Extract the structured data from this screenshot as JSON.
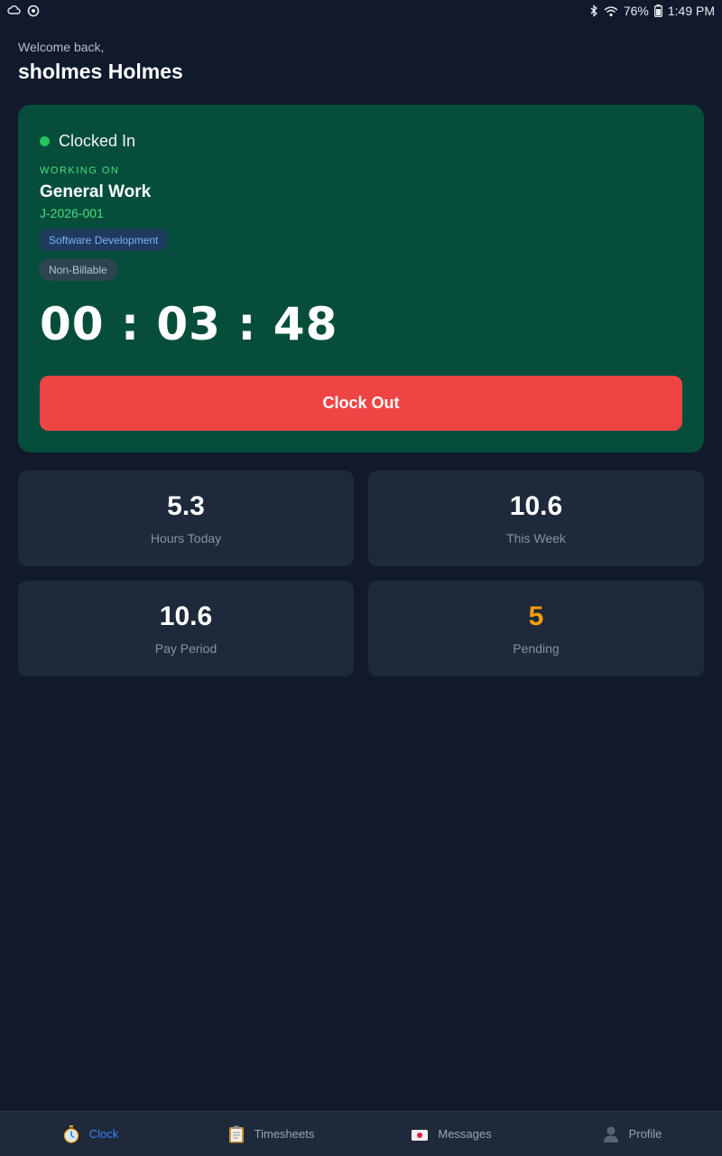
{
  "status_bar": {
    "battery": "76%",
    "time": "1:49 PM"
  },
  "greeting": {
    "welcome": "Welcome back,",
    "name": "sholmes Holmes"
  },
  "clock_card": {
    "status": "Clocked In",
    "working_on_label": "WORKING ON",
    "job_name": "General Work",
    "job_code": "J-2026-001",
    "category_tag": "Software Development",
    "billable_tag": "Non-Billable",
    "timer": "00 : 03 : 48",
    "clock_out_label": "Clock Out"
  },
  "stats": [
    {
      "value": "5.3",
      "label": "Hours Today"
    },
    {
      "value": "10.6",
      "label": "This Week"
    },
    {
      "value": "10.6",
      "label": "Pay Period"
    },
    {
      "value": "5",
      "label": "Pending"
    }
  ],
  "nav": [
    {
      "label": "Clock",
      "icon": "stopwatch-icon"
    },
    {
      "label": "Timesheets",
      "icon": "clipboard-icon"
    },
    {
      "label": "Messages",
      "icon": "mailbox-icon"
    },
    {
      "label": "Profile",
      "icon": "person-icon"
    }
  ],
  "colors": {
    "background": "#111a2c",
    "card": "#1e293b",
    "clock_card": "#064e3b",
    "accent_green": "#22c55e",
    "clock_out": "#ef4444",
    "pending": "#f59e0b",
    "active_nav": "#3b82f6"
  }
}
